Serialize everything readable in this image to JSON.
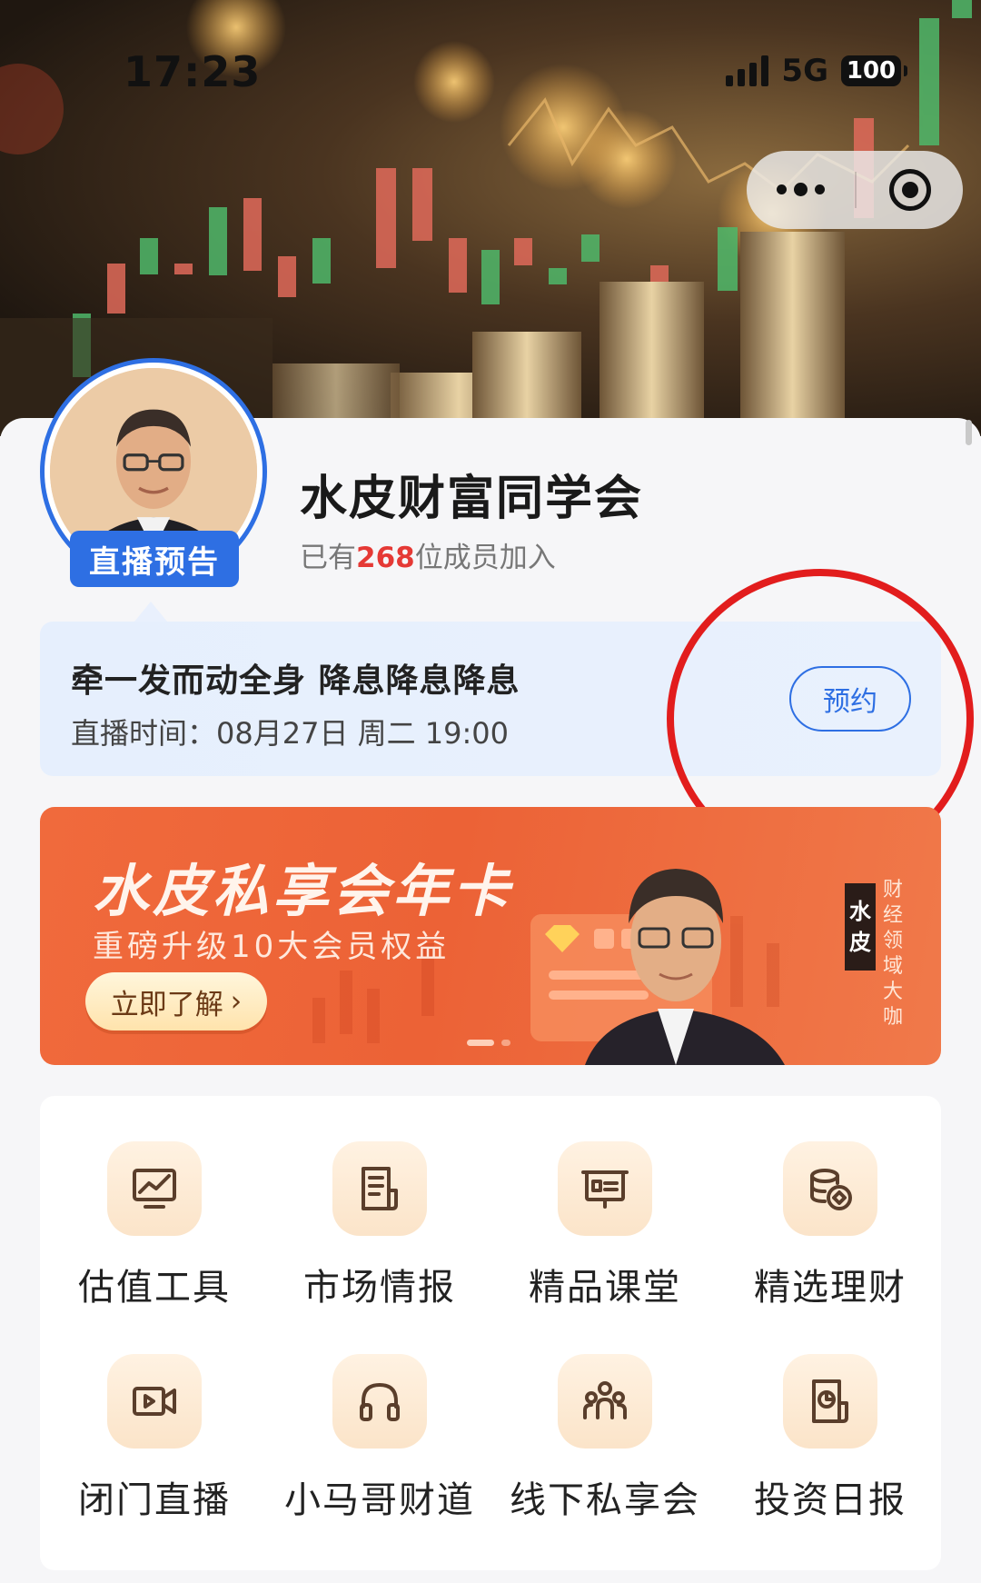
{
  "status_bar": {
    "time": "17:23",
    "network": "5G",
    "battery": "100"
  },
  "group": {
    "live_tag": "直播预告",
    "name": "水皮财富同学会",
    "member_prefix": "已有",
    "member_count": "268",
    "member_suffix": "位成员加入"
  },
  "notice": {
    "title": "牵一发而动全身 降息降息降息",
    "time_label": "直播时间：",
    "time_value": "08月27日 周二 19:00",
    "reserve_label": "预约"
  },
  "banner": {
    "title": "水皮私享会年卡",
    "subtitle": "重磅升级10大会员权益",
    "button_label": "立即了解",
    "button_chevron": "›",
    "name_chars": [
      "水",
      "皮"
    ],
    "field_chars": [
      "财",
      "经",
      "领",
      "域",
      "大",
      "咖"
    ]
  },
  "grid": [
    {
      "label": "估值工具",
      "icon": "chart-trend-icon"
    },
    {
      "label": "市场情报",
      "icon": "document-icon"
    },
    {
      "label": "精品课堂",
      "icon": "presentation-icon"
    },
    {
      "label": "精选理财",
      "icon": "coins-icon"
    },
    {
      "label": "闭门直播",
      "icon": "video-camera-icon"
    },
    {
      "label": "小马哥财道",
      "icon": "headphones-icon"
    },
    {
      "label": "线下私享会",
      "icon": "group-icon"
    },
    {
      "label": "投资日报",
      "icon": "report-icon"
    }
  ],
  "colors": {
    "accent_blue": "#2e6fe3",
    "highlight_red": "#e53935",
    "banner_orange": "#ec6236",
    "icon_stroke": "#5a3e2b"
  }
}
